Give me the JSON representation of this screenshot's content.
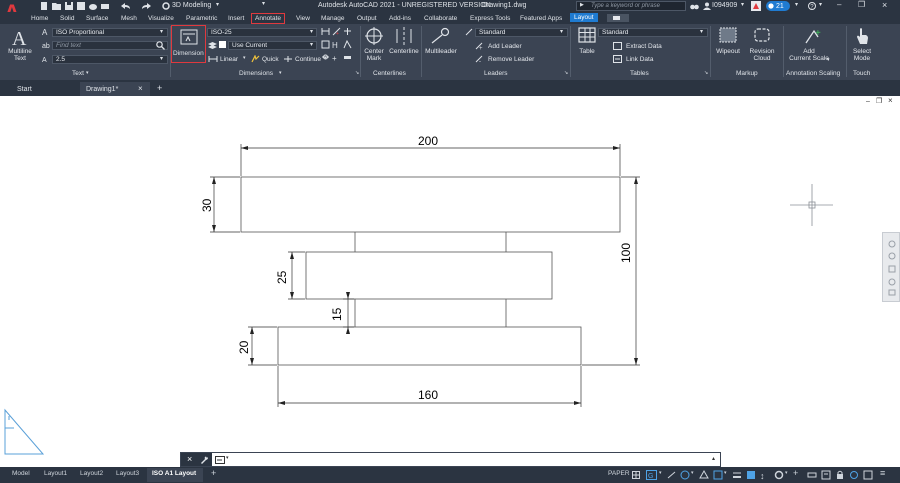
{
  "app": {
    "title": "Autodesk AutoCAD 2021 - UNREGISTERED VERSION",
    "filename": "Drawing1.dwg",
    "workspace": "3D Modeling",
    "search_placeholder": "Type a keyword or phrase",
    "user": "I094909",
    "notification_count": "21"
  },
  "ribbon_tabs": [
    "Home",
    "Solid",
    "Surface",
    "Mesh",
    "Visualize",
    "Parametric",
    "Insert",
    "Annotate",
    "View",
    "Manage",
    "Output",
    "Add-ins",
    "Collaborate",
    "Express Tools",
    "Featured Apps",
    "Layout"
  ],
  "active_tab": "Annotate",
  "text_panel": {
    "big_button": "Multiline\nText",
    "style": "ISO Proportional",
    "find_placeholder": "Find text",
    "height": "2.5",
    "title": "Text"
  },
  "dimensions_panel": {
    "big_button": "Dimension",
    "style": "ISO-25",
    "layer": "Use Current",
    "linear": "Linear",
    "quick": "Quick",
    "continue": "Continue",
    "title": "Dimensions"
  },
  "centerlines_panel": {
    "center_mark": "Center\nMark",
    "centerline": "Centerline",
    "title": "Centerlines"
  },
  "leaders_panel": {
    "multileader": "Multileader",
    "style": "Standard",
    "add": "Add Leader",
    "remove": "Remove Leader",
    "title": "Leaders"
  },
  "tables_panel": {
    "table": "Table",
    "style": "Standard",
    "extract": "Extract Data",
    "link": "Link Data",
    "title": "Tables"
  },
  "markup_panel": {
    "wipeout": "Wipeout",
    "revision": "Revision\nCloud",
    "title": "Markup"
  },
  "scaling_panel": {
    "add_scale": "Add\nCurrent Scale",
    "title": "Annotation Scaling"
  },
  "touch_panel": {
    "select_mode": "Select\nMode",
    "title": "Touch"
  },
  "doc_tabs": [
    "Start",
    "Drawing1*"
  ],
  "drawing": {
    "dim_top": "200",
    "dim_bottom": "160",
    "dim_right": "100",
    "dim_30": "30",
    "dim_25": "25",
    "dim_15": "15",
    "dim_20": "20"
  },
  "layout_tabs": [
    "Model",
    "Layout1",
    "Layout2",
    "Layout3",
    "ISO A1 Layout"
  ],
  "active_layout": "ISO A1 Layout",
  "status": {
    "paper": "PAPER"
  },
  "colors": {
    "active_outline": "#e0393e",
    "context_tab": "#1f7bd1",
    "ribbon_bg": "#3b4453",
    "title_bg": "#2b3441"
  }
}
